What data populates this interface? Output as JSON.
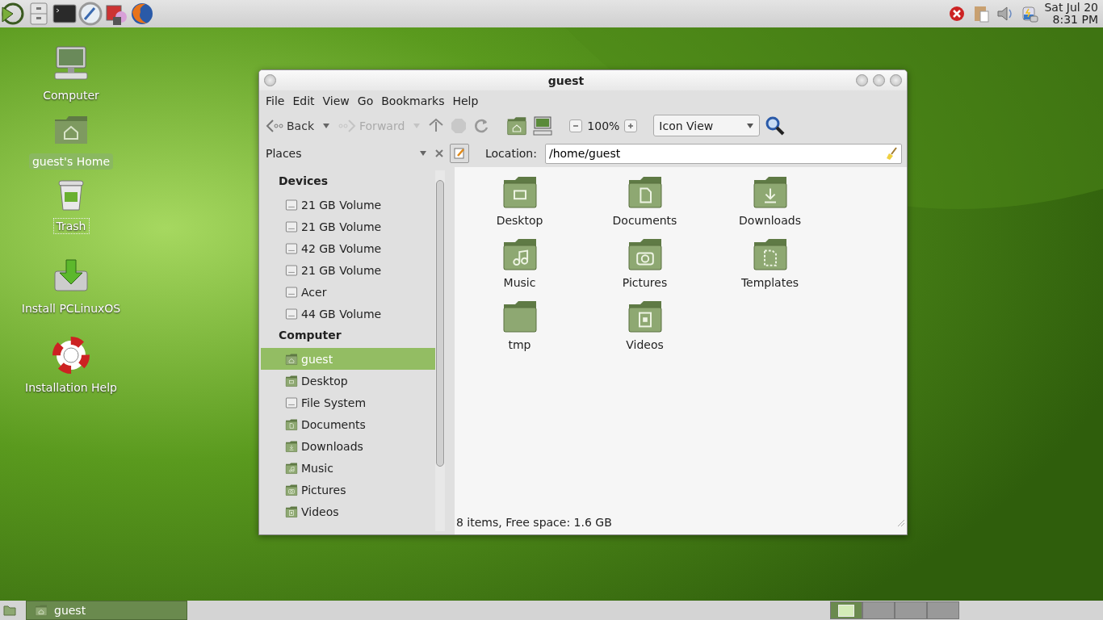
{
  "top_panel": {
    "launchers": [
      {
        "kind": "menu"
      },
      {
        "kind": "files"
      },
      {
        "kind": "terminal"
      },
      {
        "kind": "settings"
      },
      {
        "kind": "software"
      },
      {
        "kind": "browser"
      }
    ],
    "tray": [
      {
        "kind": "error"
      },
      {
        "kind": "clipboard"
      },
      {
        "kind": "volume"
      },
      {
        "kind": "power"
      }
    ],
    "clock": {
      "date": "Sat Jul 20",
      "time": "8:31 PM"
    }
  },
  "desktop_icons": [
    {
      "label": "Computer",
      "kind": "computer",
      "selected": false,
      "focused": false
    },
    {
      "label": "guest's Home",
      "kind": "home",
      "selected": true,
      "focused": false
    },
    {
      "label": "Trash",
      "kind": "trash",
      "selected": false,
      "focused": true
    },
    {
      "label": "Install PCLinuxOS",
      "kind": "install",
      "selected": false,
      "focused": false
    },
    {
      "label": "Installation Help",
      "kind": "help",
      "selected": false,
      "focused": false
    }
  ],
  "window": {
    "title": "guest",
    "menu": [
      "File",
      "Edit",
      "View",
      "Go",
      "Bookmarks",
      "Help"
    ],
    "toolbar": {
      "back": {
        "label": "Back",
        "disabled": false
      },
      "forward": {
        "label": "Forward",
        "disabled": true
      },
      "up_disabled": false,
      "stop_disabled": true,
      "zoom": "100%",
      "view": "Icon View"
    },
    "sidebar": {
      "title": "Places",
      "sections": [
        {
          "heading": "Devices",
          "items": [
            {
              "label": "21 GB Volume",
              "kind": "drive",
              "selected": false
            },
            {
              "label": "21 GB Volume",
              "kind": "drive",
              "selected": false
            },
            {
              "label": "42 GB Volume",
              "kind": "drive",
              "selected": false
            },
            {
              "label": "21 GB Volume",
              "kind": "drive",
              "selected": false
            },
            {
              "label": "Acer",
              "kind": "drive",
              "selected": false
            },
            {
              "label": "44 GB Volume",
              "kind": "drive",
              "selected": false
            }
          ]
        },
        {
          "heading": "Computer",
          "items": [
            {
              "label": "guest",
              "kind": "home",
              "selected": true
            },
            {
              "label": "Desktop",
              "kind": "desktop",
              "selected": false
            },
            {
              "label": "File System",
              "kind": "drive",
              "selected": false
            },
            {
              "label": "Documents",
              "kind": "documents",
              "selected": false
            },
            {
              "label": "Downloads",
              "kind": "downloads",
              "selected": false
            },
            {
              "label": "Music",
              "kind": "music",
              "selected": false
            },
            {
              "label": "Pictures",
              "kind": "pictures",
              "selected": false
            },
            {
              "label": "Videos",
              "kind": "videos",
              "selected": false
            }
          ]
        }
      ]
    },
    "location": {
      "label": "Location:",
      "value": "/home/guest"
    },
    "files": [
      {
        "name": "Desktop",
        "kind": "desktop"
      },
      {
        "name": "Documents",
        "kind": "documents"
      },
      {
        "name": "Downloads",
        "kind": "downloads"
      },
      {
        "name": "Music",
        "kind": "music"
      },
      {
        "name": "Pictures",
        "kind": "pictures"
      },
      {
        "name": "Templates",
        "kind": "templates"
      },
      {
        "name": "tmp",
        "kind": "plain"
      },
      {
        "name": "Videos",
        "kind": "videos"
      }
    ],
    "status": "8 items, Free space: 1.6 GB"
  },
  "taskbar": {
    "tasks": [
      {
        "label": "guest",
        "selected": true
      }
    ],
    "workspaces": [
      {
        "selected": true
      },
      {
        "selected": false
      },
      {
        "selected": false
      },
      {
        "selected": false
      }
    ]
  }
}
